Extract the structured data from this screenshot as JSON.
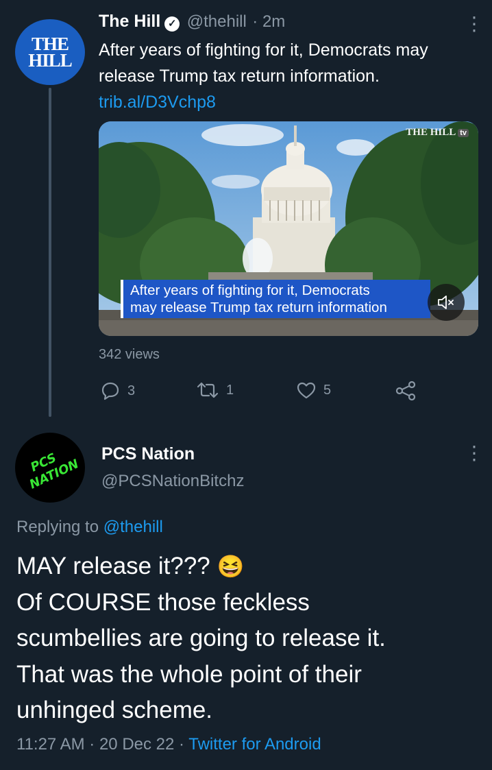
{
  "tweet": {
    "author_name": "The Hill",
    "handle": "@thehill",
    "time": "· 2m",
    "avatar_text_line1": "THE",
    "avatar_text_line2": "HILL",
    "text_line1": "After years of fighting for it, Democrats may",
    "text_line2": "release Trump tax return information.",
    "link": "trib.al/D3Vchp8",
    "video": {
      "watermark": "THE HILL",
      "watermark_badge": "tv",
      "caption_line1": "After years of fighting for it, Democrats",
      "caption_line2": "may release Trump tax return information"
    },
    "views": "342 views",
    "replies": "3",
    "retweets": "1",
    "likes": "5"
  },
  "reply": {
    "author_name": "PCS Nation",
    "handle": "@PCSNationBitchz",
    "avatar_text": "PCS NATION",
    "replying_prefix": "Replying to",
    "replying_to": "@thehill",
    "line1": "MAY release it???",
    "emoji": "😆",
    "line2": "Of COURSE those feckless",
    "line3": "scumbellies are going to release it.",
    "line4": "That was the whole point of their",
    "line5": "unhinged scheme.",
    "timestamp": "11:27 AM · 20 Dec 22 ·",
    "source": "Twitter for Android"
  },
  "colors": {
    "background": "#15202b",
    "link": "#1d9bf0",
    "muted": "#8b98a5",
    "hill_blue": "#1a5ec1",
    "caption_blue": "#1e56c6",
    "pcs_green": "#39e635"
  }
}
